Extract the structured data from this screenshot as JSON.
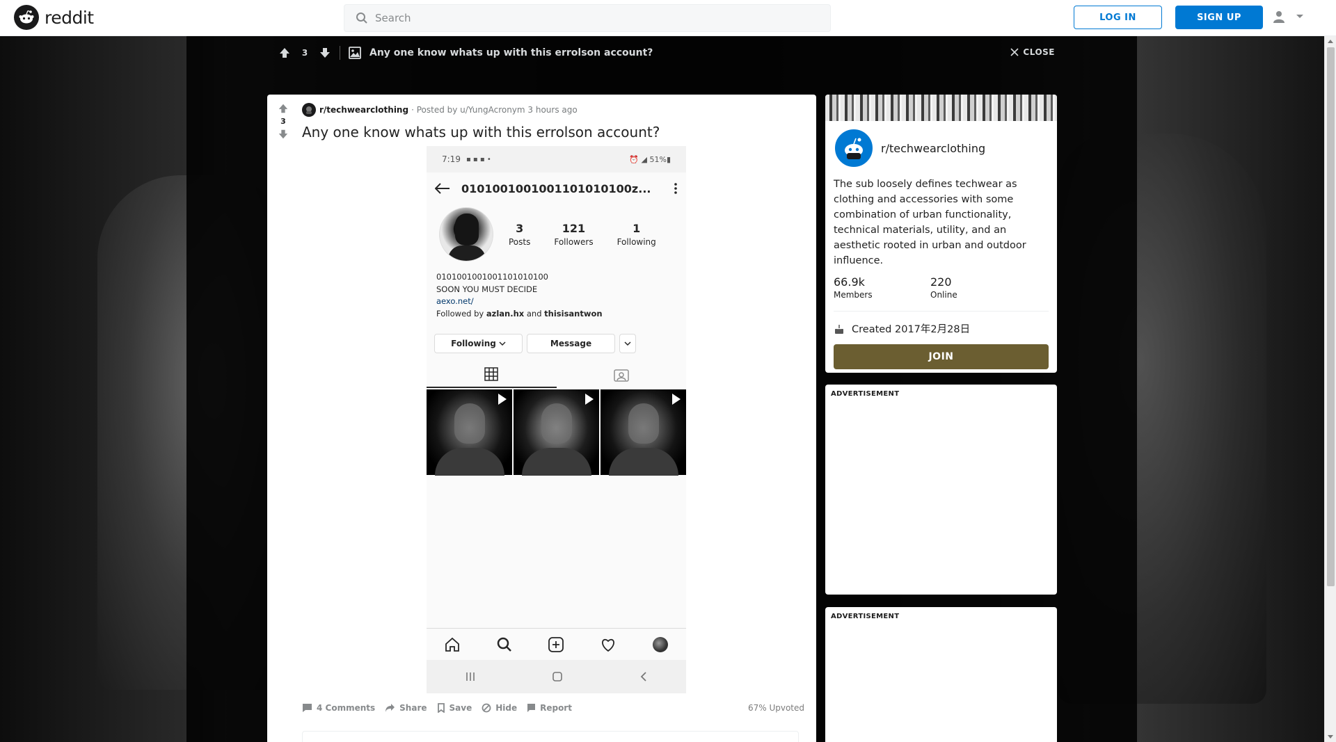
{
  "header": {
    "logo_text": "reddit",
    "search_placeholder": "Search",
    "login_label": "LOG IN",
    "signup_label": "SIGN UP"
  },
  "topbar": {
    "vote_count": "3",
    "title": "Any one know whats up with this errolson account?",
    "close_label": "CLOSE"
  },
  "post": {
    "vote_count": "3",
    "subreddit": "r/techwearclothing",
    "posted_by": "· Posted by u/YungAcronym 3 hours ago",
    "title": "Any one know whats up with this errolson account?",
    "screenshot": {
      "status_time": "7:19",
      "status_right": "51%",
      "username": "0101001001001101010100z...",
      "stats": [
        {
          "num": "3",
          "label": "Posts"
        },
        {
          "num": "121",
          "label": "Followers"
        },
        {
          "num": "1",
          "label": "Following"
        }
      ],
      "bio_name": "0101001001001101010100",
      "bio_line": "SOON YOU MUST DECIDE",
      "bio_link": "aexo.net/",
      "followed_prefix": "Followed by",
      "followed_user1": "azlan.hx",
      "followed_and": "and",
      "followed_user2": "thisisantwon",
      "following_btn": "Following",
      "message_btn": "Message"
    },
    "footer": {
      "comments": "4 Comments",
      "share": "Share",
      "save": "Save",
      "hide": "Hide",
      "report": "Report",
      "upvoted": "67% Upvoted"
    }
  },
  "sidebar": {
    "name": "r/techwearclothing",
    "description": "The sub loosely defines techwear as clothing and accessories with some combination of urban functionality, technical materials, utility, and an aesthetic rooted in urban and outdoor influence.",
    "members_num": "66.9k",
    "members_label": "Members",
    "online_num": "220",
    "online_label": "Online",
    "created": "Created 2017年2月28日",
    "join_label": "JOIN",
    "ad_label_1": "ADVERTISEMENT",
    "ad_label_2": "ADVERTISEMENT"
  },
  "colors": {
    "brand_blue": "#0079d3",
    "join_button": "#6b5e31"
  }
}
